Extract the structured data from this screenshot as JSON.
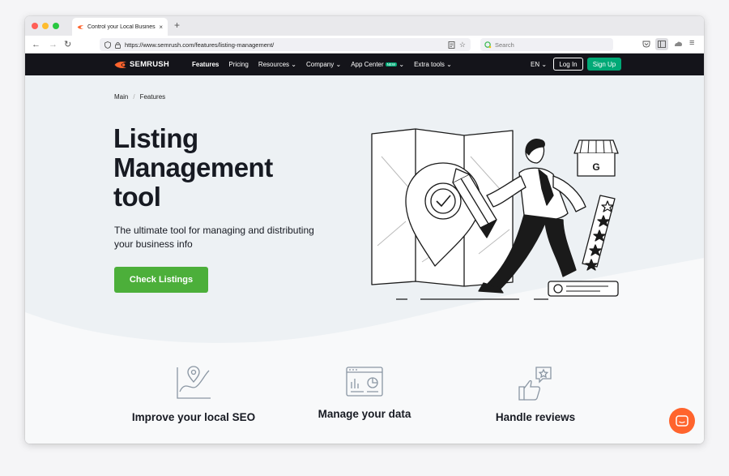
{
  "browser": {
    "tab_title": "Control your Local Business Lis",
    "tab_close": "×",
    "new_tab": "+",
    "url": "https://www.semrush.com/features/listing-management/",
    "search_placeholder": "Search"
  },
  "nav": {
    "logo": "SEMRUSH",
    "links": [
      "Features",
      "Pricing",
      "Resources",
      "Company",
      "App Center",
      "Extra tools"
    ],
    "new_badge": "NEW",
    "lang": "EN",
    "login": "Log In",
    "signup": "Sign Up"
  },
  "breadcrumb": [
    "Main",
    "Features"
  ],
  "hero": {
    "title_lines": [
      "Listing",
      "Management",
      "tool"
    ],
    "subtitle_lines": [
      "The ultimate tool for managing and distributing",
      "your business info"
    ],
    "cta": "Check Listings",
    "illustration_letter": "G"
  },
  "features": [
    {
      "icon": "map-pin-chart-icon",
      "label": "Improve your local SEO"
    },
    {
      "icon": "dashboard-icon",
      "label": "Manage your data"
    },
    {
      "icon": "thumbs-up-star-icon",
      "label": "Handle reviews"
    }
  ],
  "colors": {
    "brand_orange": "#ff642d",
    "cta_green": "#4caf3a",
    "signup_green": "#00a976",
    "nav_bg": "#14141a"
  }
}
